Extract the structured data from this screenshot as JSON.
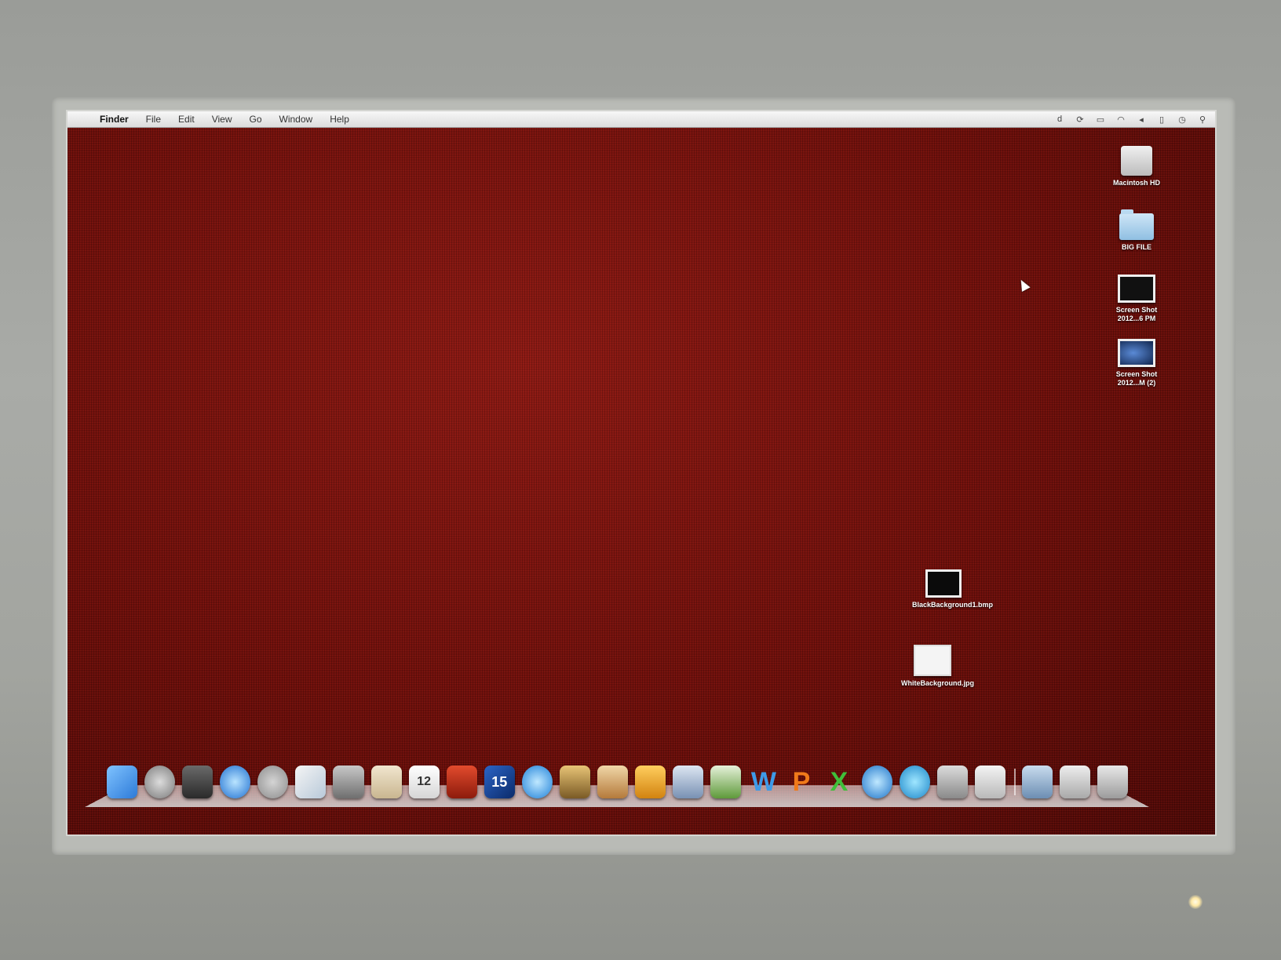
{
  "menubar": {
    "apple_icon": "apple-icon",
    "app_name": "Finder",
    "items": [
      "File",
      "Edit",
      "View",
      "Go",
      "Window",
      "Help"
    ]
  },
  "desktop_icons": [
    {
      "label": "Macintosh HD",
      "icon": "hard-drive-icon"
    },
    {
      "label": "BIG FILE",
      "icon": "folder-icon"
    },
    {
      "label": "Screen Shot 2012...6 PM",
      "icon": "screenshot-file-icon"
    },
    {
      "label": "Screen Shot 2012...M (2)",
      "icon": "screenshot-file-icon"
    },
    {
      "label": "BlackBackground1.bmp",
      "icon": "image-file-icon"
    },
    {
      "label": "WhiteBackground.jpg",
      "icon": "image-file-icon"
    }
  ],
  "dock": {
    "calendar_day": "12",
    "ical_badge": "15",
    "word_letter": "W",
    "powerpoint_letter": "P",
    "excel_letter": "X",
    "apps": [
      "finder-icon",
      "launchpad-icon",
      "mission-control-icon",
      "safari-icon",
      "system-preferences-icon",
      "preview-icon",
      "facetime-icon",
      "address-book-icon",
      "calendar-icon",
      "photo-booth-icon",
      "ical-icon",
      "itunes-icon",
      "iphoto-icon",
      "garageband-icon",
      "keynote-icon",
      "mail-icon",
      "numbers-icon",
      "word-icon",
      "powerpoint-icon",
      "excel-icon",
      "quicktime-icon",
      "quicktime-x-icon",
      "utility-icon",
      "messages-icon"
    ],
    "right_items": [
      "documents-stack-icon",
      "downloads-stack-icon",
      "trash-icon"
    ]
  },
  "colors": {
    "wallpaper": "#6e0f0c",
    "bezel": "#a9aba7"
  }
}
